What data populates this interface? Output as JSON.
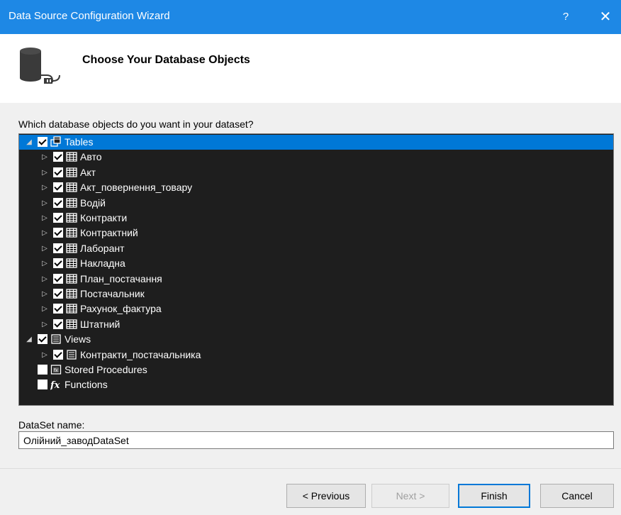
{
  "window": {
    "title": "Data Source Configuration Wizard",
    "help_label": "?",
    "close_label": "✕"
  },
  "header": {
    "heading": "Choose Your Database Objects"
  },
  "question": "Which database objects do you want in your dataset?",
  "tree": {
    "rows": [
      {
        "label": "Tables",
        "level": 0,
        "expander": "◢",
        "checked": true,
        "icon": "tables-icon",
        "selected": true
      },
      {
        "label": "Авто",
        "level": 1,
        "expander": "▷",
        "checked": true,
        "icon": "table-icon"
      },
      {
        "label": "Акт",
        "level": 1,
        "expander": "▷",
        "checked": true,
        "icon": "table-icon"
      },
      {
        "label": "Акт_повернення_товару",
        "level": 1,
        "expander": "▷",
        "checked": true,
        "icon": "table-icon"
      },
      {
        "label": "Водій",
        "level": 1,
        "expander": "▷",
        "checked": true,
        "icon": "table-icon"
      },
      {
        "label": "Контракти",
        "level": 1,
        "expander": "▷",
        "checked": true,
        "icon": "table-icon"
      },
      {
        "label": "Контрактний",
        "level": 1,
        "expander": "▷",
        "checked": true,
        "icon": "table-icon"
      },
      {
        "label": "Лаборант",
        "level": 1,
        "expander": "▷",
        "checked": true,
        "icon": "table-icon"
      },
      {
        "label": "Накладна",
        "level": 1,
        "expander": "▷",
        "checked": true,
        "icon": "table-icon"
      },
      {
        "label": "План_постачання",
        "level": 1,
        "expander": "▷",
        "checked": true,
        "icon": "table-icon"
      },
      {
        "label": "Постачальник",
        "level": 1,
        "expander": "▷",
        "checked": true,
        "icon": "table-icon"
      },
      {
        "label": "Рахунок_фактура",
        "level": 1,
        "expander": "▷",
        "checked": true,
        "icon": "table-icon"
      },
      {
        "label": "Штатний",
        "level": 1,
        "expander": "▷",
        "checked": true,
        "icon": "table-icon"
      },
      {
        "label": "Views",
        "level": 0,
        "expander": "◢",
        "checked": true,
        "icon": "view-icon"
      },
      {
        "label": "Контракти_постачальника",
        "level": 1,
        "expander": "▷",
        "checked": true,
        "icon": "view-icon"
      },
      {
        "label": "Stored Procedures",
        "level": 0,
        "expander": "",
        "checked": false,
        "icon": "stored-procedure-icon"
      },
      {
        "label": "Functions",
        "level": 0,
        "expander": "",
        "checked": false,
        "icon": "function-icon"
      }
    ]
  },
  "dataset": {
    "label": "DataSet name:",
    "value": "Олійний_заводDataSet"
  },
  "buttons": {
    "previous": "< Previous",
    "next": "Next >",
    "finish": "Finish",
    "cancel": "Cancel"
  },
  "colors": {
    "titlebar": "#1e88e5",
    "selection": "#0078d7",
    "tree_background": "#1e1e1e"
  }
}
